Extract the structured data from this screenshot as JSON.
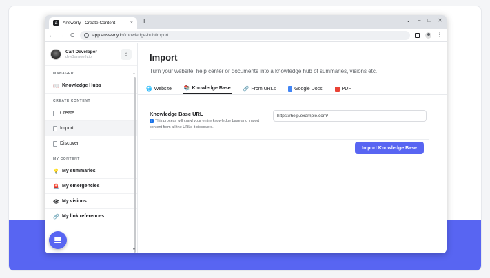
{
  "browser": {
    "tab_title": "Answerly - Create Content",
    "tab_close": "×",
    "new_tab": "+",
    "url_host": "app.answerly.io",
    "url_path": "/knowledge-hub/import",
    "window_controls": [
      "⌄",
      "–",
      "□",
      "✕"
    ]
  },
  "profile": {
    "name": "Carl Developer",
    "email": "dev@answerly.io"
  },
  "sidebar": {
    "manager_label": "MANAGER",
    "knowledge_hubs": "Knowledge Hubs",
    "create_content_label": "CREATE CONTENT",
    "create": "Create",
    "import": "Import",
    "discover": "Discover",
    "my_content_label": "MY CONTENT",
    "my_summaries": "My summaries",
    "my_emergencies": "My emergencies",
    "my_visions": "My visions",
    "my_link_references": "My link references"
  },
  "main": {
    "title": "Import",
    "subtitle": "Turn your website, help center or documents into a knowledge hub of summaries, visions etc.",
    "tabs": [
      {
        "label": "Website",
        "icon": "globe-icon"
      },
      {
        "label": "Knowledge Base",
        "icon": "books-icon"
      },
      {
        "label": "From URLs",
        "icon": "link-icon"
      },
      {
        "label": "Google Docs",
        "icon": "google-docs-icon"
      },
      {
        "label": "PDF",
        "icon": "pdf-icon"
      }
    ],
    "active_tab": "Knowledge Base",
    "form": {
      "label": "Knowledge Base URL",
      "help": "This process will crawl your entire knowledge base and import content from all the URLs it discovers.",
      "input_value": "https://help.example.com/",
      "submit": "Import Knowledge Base"
    }
  },
  "colors": {
    "accent": "#5865f2"
  }
}
